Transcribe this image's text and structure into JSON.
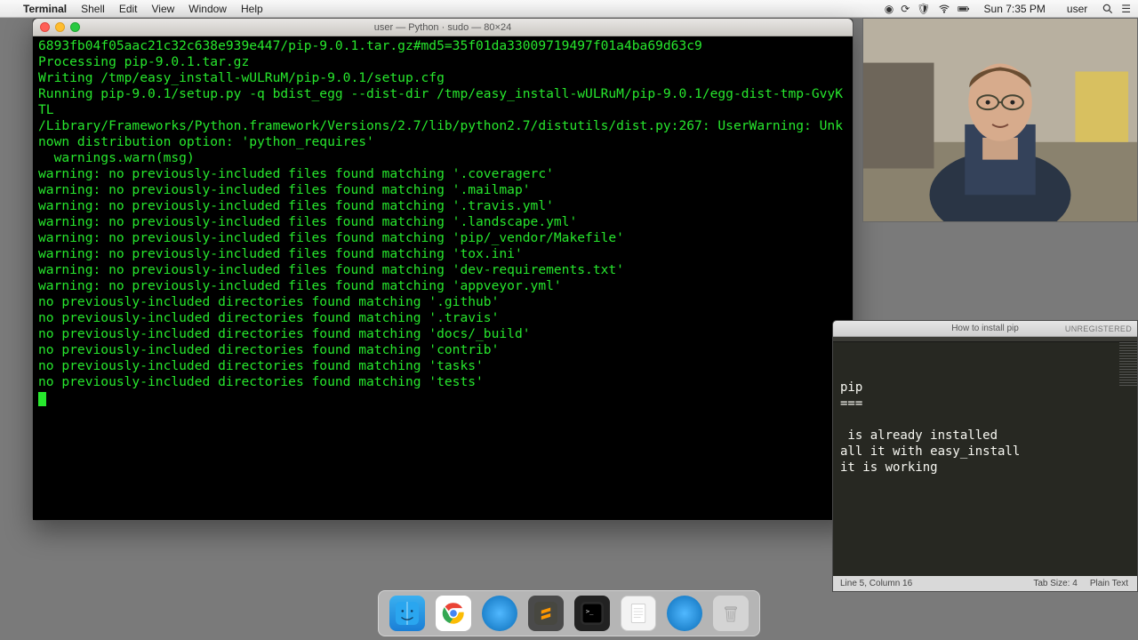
{
  "menubar": {
    "app": "Terminal",
    "items": [
      "Shell",
      "Edit",
      "View",
      "Window",
      "Help"
    ],
    "right": {
      "time": "Sun 7:35 PM",
      "user": "user"
    }
  },
  "terminal": {
    "title": "user — Python · sudo — 80×24",
    "lines": [
      "6893fb04f05aac21c32c638e939e447/pip-9.0.1.tar.gz#md5=35f01da33009719497f01a4ba69d63c9",
      "Processing pip-9.0.1.tar.gz",
      "Writing /tmp/easy_install-wULRuM/pip-9.0.1/setup.cfg",
      "Running pip-9.0.1/setup.py -q bdist_egg --dist-dir /tmp/easy_install-wULRuM/pip-9.0.1/egg-dist-tmp-GvyKTL",
      "/Library/Frameworks/Python.framework/Versions/2.7/lib/python2.7/distutils/dist.py:267: UserWarning: Unknown distribution option: 'python_requires'",
      "  warnings.warn(msg)",
      "warning: no previously-included files found matching '.coveragerc'",
      "warning: no previously-included files found matching '.mailmap'",
      "warning: no previously-included files found matching '.travis.yml'",
      "warning: no previously-included files found matching '.landscape.yml'",
      "warning: no previously-included files found matching 'pip/_vendor/Makefile'",
      "warning: no previously-included files found matching 'tox.ini'",
      "warning: no previously-included files found matching 'dev-requirements.txt'",
      "warning: no previously-included files found matching 'appveyor.yml'",
      "no previously-included directories found matching '.github'",
      "no previously-included directories found matching '.travis'",
      "no previously-included directories found matching 'docs/_build'",
      "no previously-included directories found matching 'contrib'",
      "no previously-included directories found matching 'tasks'",
      "no previously-included directories found matching 'tests'"
    ]
  },
  "sublime": {
    "tab_title": "How to install pip",
    "unregistered": "UNREGISTERED",
    "body_lines": [
      "pip",
      "===",
      "",
      " is already installed",
      "all it with easy_install",
      "it is working"
    ],
    "status_left": "Line 5, Column 16",
    "status_tab": "Tab Size: 4",
    "status_syntax": "Plain Text"
  },
  "dock": {
    "items": [
      "finder",
      "chrome",
      "app1",
      "sublime",
      "terminal",
      "document",
      "app2",
      "trash"
    ]
  }
}
